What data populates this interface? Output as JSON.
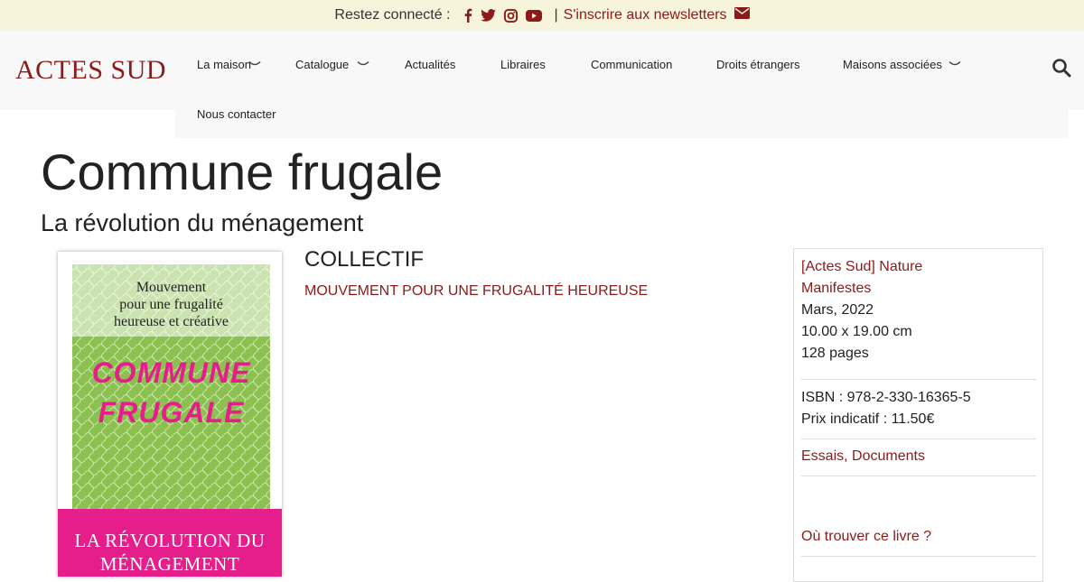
{
  "topbar": {
    "connect_label": "Restez connecté :",
    "separator": "|",
    "newsletter_label": "S'inscrire aux newsletters",
    "social_icons": [
      "facebook-icon",
      "twitter-icon",
      "instagram-icon",
      "youtube-icon"
    ],
    "accent": "#8b1a1a"
  },
  "header": {
    "logo": "ACTES SUD",
    "nav": {
      "maison": "La maison",
      "catalogue": "Catalogue",
      "actualites": "Actualités",
      "libraires": "Libraires",
      "communication": "Communication",
      "droits": "Droits étrangers",
      "maisons": "Maisons associées",
      "contact": "Nous contacter"
    }
  },
  "book": {
    "title": "Commune frugale",
    "subtitle": "La révolution du ménagement",
    "author": "COLLECTIF",
    "collection_link": "MOUVEMENT POUR UNE FRUGALITÉ HEUREUSE",
    "cover": {
      "top_line1": "Mouvement",
      "top_line2": "pour une frugalité",
      "top_line3": "heureuse et créative",
      "title_line1": "COMMUNE",
      "title_line2": "FRUGALE",
      "bottom_line1": "LA RÉVOLUTION DU",
      "bottom_line2": "MÉNAGEMENT",
      "green": "#8cc152",
      "pink": "#e61e8c"
    }
  },
  "details": {
    "series": "[Actes Sud] Nature",
    "sub_series": "Manifestes",
    "date": "Mars, 2022",
    "dimensions": "10.00 x 19.00 cm",
    "pages": "128 pages",
    "isbn": "ISBN : 978-2-330-16365-5",
    "price": "Prix indicatif : 11.50€",
    "genres": "Essais, Documents",
    "where_to_find": "Où trouver ce livre ?"
  }
}
